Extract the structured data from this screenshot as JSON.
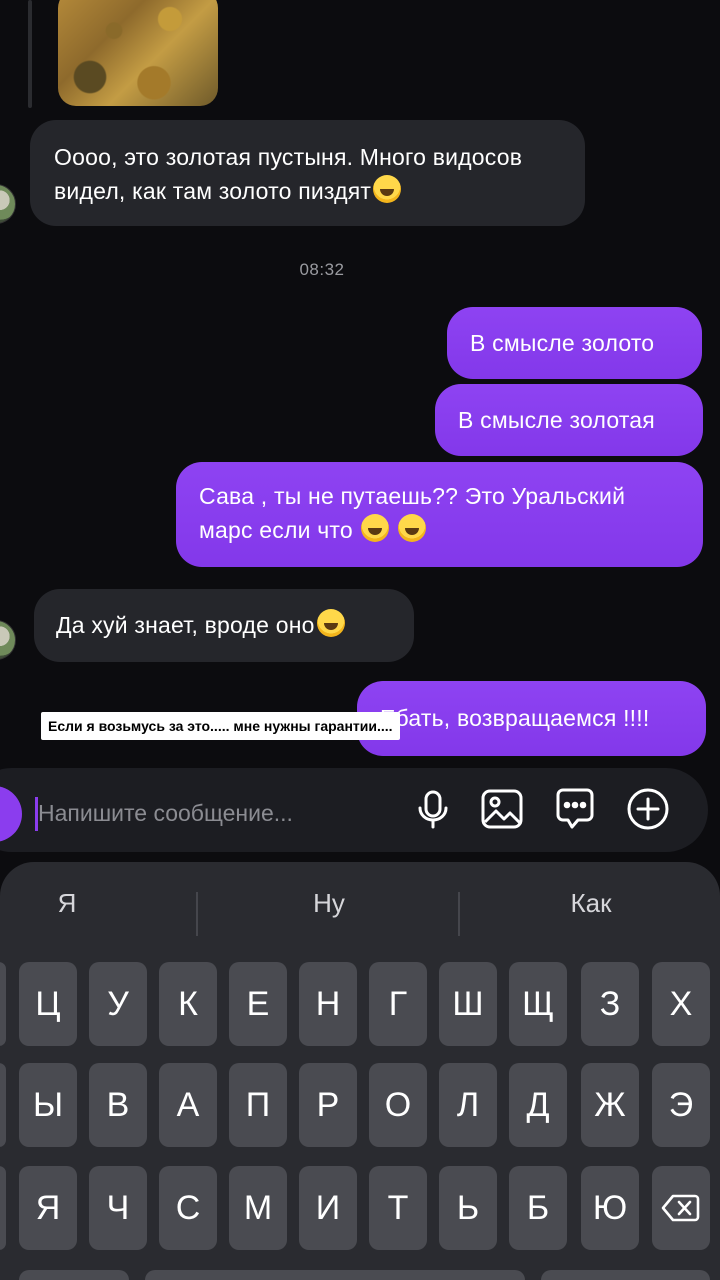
{
  "chat": {
    "incoming_1": "Оооо, это золотая пустыня. Много видосов видел, как там золото пиздят",
    "timestamp": "08:32",
    "outgoing_1": "В смысле золото",
    "outgoing_2": "В смысле золотая",
    "outgoing_3": "Сава , ты не путаешь?? Это Уральский марс если что",
    "incoming_2": "Да хуй знает, вроде оно",
    "outgoing_4": "Ебать, возвращаемся !!!!"
  },
  "caption_overlay": "Если я возьмусь за это..... мне нужны гарантии....",
  "composer": {
    "placeholder": "Напишите сообщение...",
    "icons": [
      "microphone-icon",
      "gallery-icon",
      "sticker-chat-icon",
      "add-icon"
    ]
  },
  "keyboard": {
    "suggestions": [
      "Я",
      "Ну",
      "Как"
    ],
    "row1": [
      "Ц",
      "У",
      "К",
      "Е",
      "Н",
      "Г",
      "Ш",
      "Щ",
      "З",
      "Х"
    ],
    "row2": [
      "Ы",
      "В",
      "А",
      "П",
      "Р",
      "О",
      "Л",
      "Д",
      "Ж",
      "Э"
    ],
    "row3": [
      "Я",
      "Ч",
      "С",
      "М",
      "И",
      "Т",
      "Ь",
      "Б",
      "Ю"
    ]
  },
  "colors": {
    "background": "#0c0c0f",
    "incoming_bubble": "#25262b",
    "outgoing_bubble": "#8b3dee",
    "keyboard": "#2a2b30",
    "key": "#4a4b51"
  }
}
